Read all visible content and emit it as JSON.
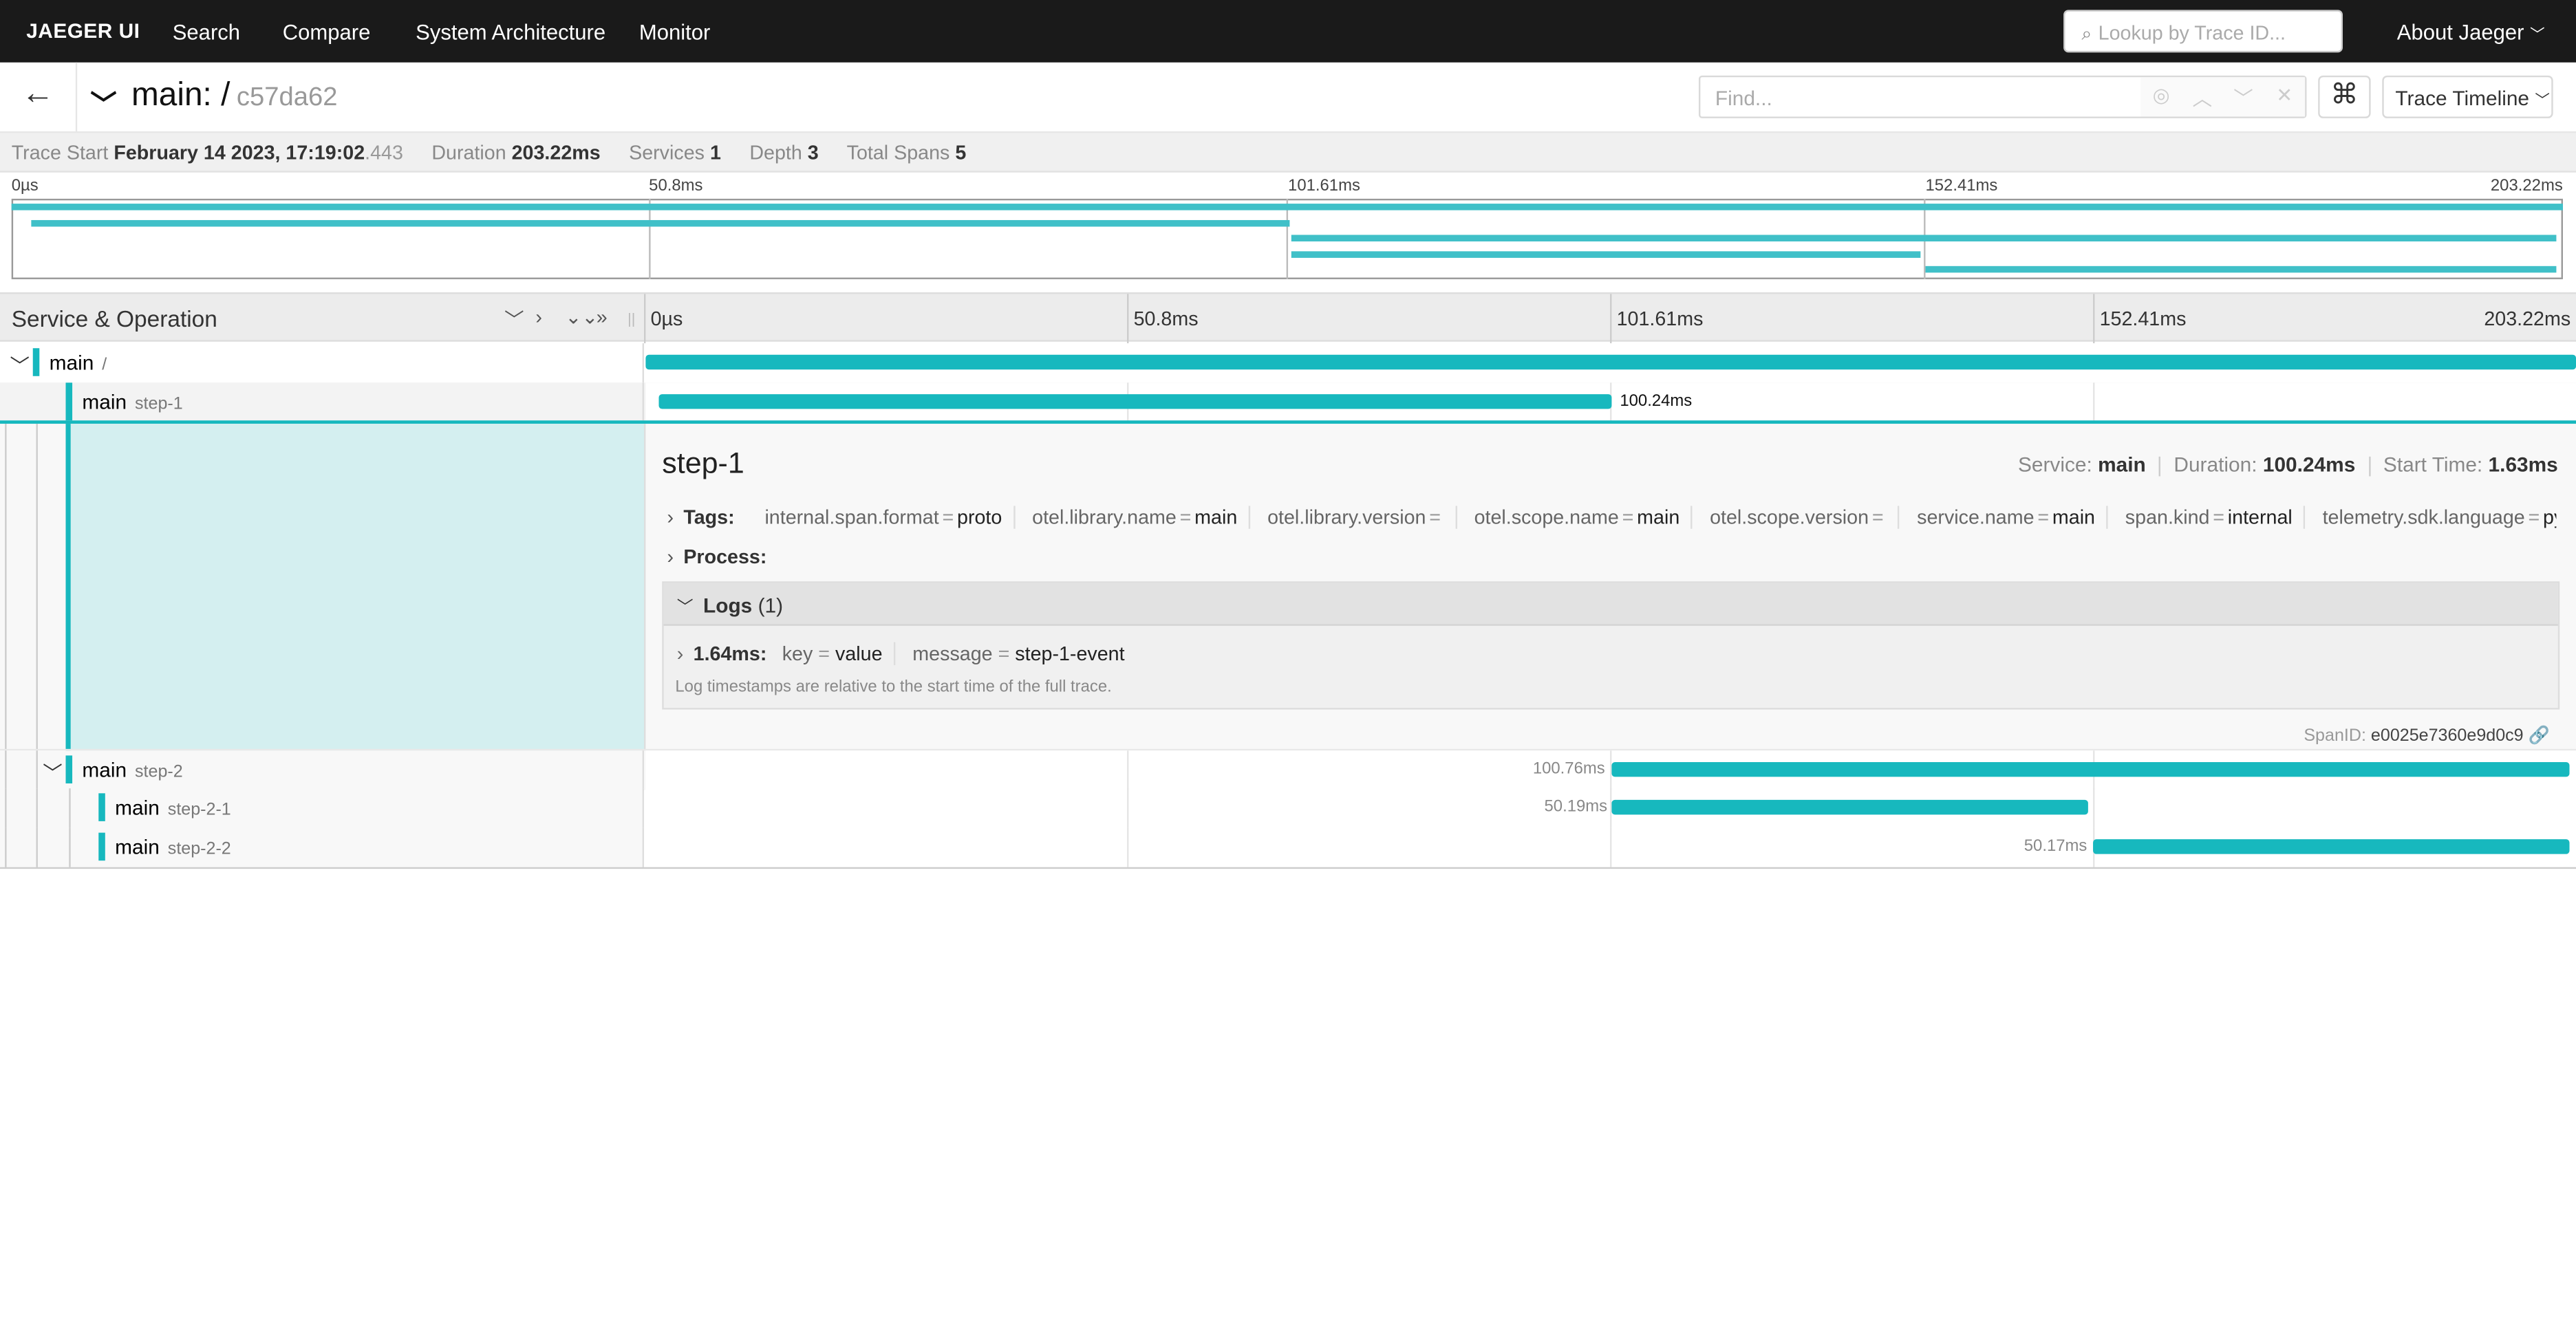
{
  "nav": {
    "brand": "JAEGER UI",
    "items": [
      "Search",
      "Compare",
      "System Architecture",
      "Monitor"
    ],
    "lookup_placeholder": "Lookup by Trace ID...",
    "about": "About Jaeger"
  },
  "trace": {
    "name": "main: /",
    "id": "c57da62",
    "find_placeholder": "Find...",
    "view": "Trace Timeline"
  },
  "summary": {
    "start_label": "Trace Start",
    "start_value": "February 14 2023, 17:19:02",
    "start_ms": ".443",
    "duration_label": "Duration",
    "duration_value": "203.22ms",
    "services_label": "Services",
    "services_value": "1",
    "depth_label": "Depth",
    "depth_value": "3",
    "spans_label": "Total Spans",
    "spans_value": "5"
  },
  "ticks": [
    "0µs",
    "50.8ms",
    "101.61ms",
    "152.41ms",
    "203.22ms"
  ],
  "header": {
    "service_operation": "Service & Operation"
  },
  "spans": [
    {
      "service": "main",
      "operation": "/",
      "start_ms": 0,
      "duration_ms": 203.22,
      "label": ""
    },
    {
      "service": "main",
      "operation": "step-1",
      "start_ms": 1.63,
      "duration_ms": 100.24,
      "label": "100.24ms"
    },
    {
      "service": "main",
      "operation": "step-2",
      "start_ms": 101.9,
      "duration_ms": 100.76,
      "label": "100.76ms"
    },
    {
      "service": "main",
      "operation": "step-2-1",
      "start_ms": 101.9,
      "duration_ms": 50.19,
      "label": "50.19ms"
    },
    {
      "service": "main",
      "operation": "step-2-2",
      "start_ms": 152.5,
      "duration_ms": 50.17,
      "label": "50.17ms"
    }
  ],
  "detail": {
    "title": "step-1",
    "service_label": "Service:",
    "service": "main",
    "duration_label": "Duration:",
    "duration": "100.24ms",
    "start_label": "Start Time:",
    "start": "1.63ms",
    "tags_label": "Tags:",
    "tags": [
      {
        "k": "internal.span.format",
        "v": "proto"
      },
      {
        "k": "otel.library.name",
        "v": "main"
      },
      {
        "k": "otel.library.version",
        "v": ""
      },
      {
        "k": "otel.scope.name",
        "v": "main"
      },
      {
        "k": "otel.scope.version",
        "v": ""
      },
      {
        "k": "service.name",
        "v": "main"
      },
      {
        "k": "span.kind",
        "v": "internal"
      },
      {
        "k": "telemetry.sdk.language",
        "v": "python…"
      }
    ],
    "process_label": "Process:",
    "logs_label": "Logs",
    "logs_count": "(1)",
    "log_time": "1.64ms:",
    "log_fields": [
      {
        "k": "key",
        "v": "value"
      },
      {
        "k": "message",
        "v": "step-1-event"
      }
    ],
    "log_note": "Log timestamps are relative to the start time of the full trace.",
    "spanid_label": "SpanID:",
    "spanid": "e0025e7360e9d0c9"
  },
  "colors": {
    "accent": "#17b8be",
    "nav_bg": "#1a1a1a"
  }
}
